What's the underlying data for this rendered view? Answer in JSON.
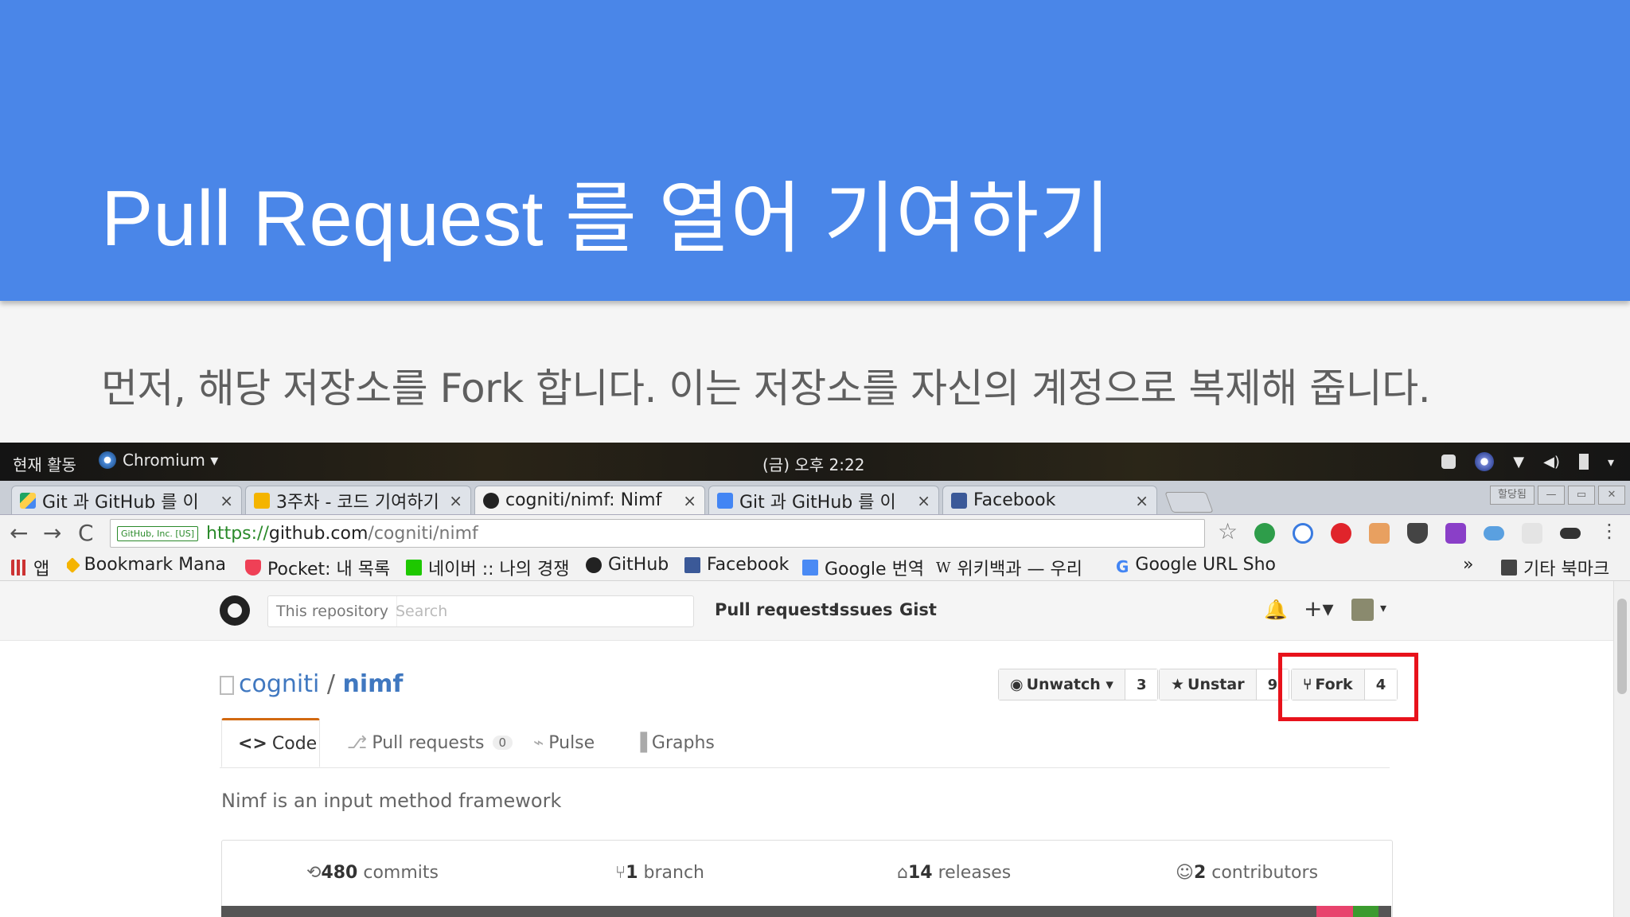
{
  "slide": {
    "title": "Pull Request 를 열어 기여하기",
    "subtitle": "먼저, 해당 저장소를 Fork 합니다. 이는 저장소를 자신의 계정으로 복제해 줍니다."
  },
  "desktop": {
    "activities": "현재 활동",
    "app_menu": "Chromium ▾",
    "clock": "(금) 오후 2:22"
  },
  "tabs": [
    {
      "title": "Git 과 GitHub 를 이",
      "close": "×"
    },
    {
      "title": "3주차 - 코드 기여하기",
      "close": "×"
    },
    {
      "title": "cogniti/nimf: Nimf",
      "close": "×"
    },
    {
      "title": "Git 과 GitHub 를 이",
      "close": "×"
    },
    {
      "title": "Facebook",
      "close": "×"
    }
  ],
  "window_controls": {
    "profile": "할당됨",
    "minimize": "—",
    "maximize": "▭",
    "close": "✕"
  },
  "toolbar": {
    "back": "←",
    "forward": "→",
    "reload": "C",
    "secure_label": "GitHub, Inc. [US]",
    "url_scheme": "https://",
    "url_host": "github.com",
    "url_path": "/cogniti/nimf"
  },
  "bookmarks": [
    {
      "label": "앱"
    },
    {
      "label": "Bookmark Mana"
    },
    {
      "label": "Pocket: 내 목록"
    },
    {
      "label": "네이버 :: 나의 경쟁"
    },
    {
      "label": "GitHub"
    },
    {
      "label": "Facebook"
    },
    {
      "label": "Google 번역"
    },
    {
      "label": "위키백과 — 우리"
    },
    {
      "label": "Google URL Sho"
    },
    {
      "label": "»"
    },
    {
      "label": "기타 북마크"
    }
  ],
  "github": {
    "search_scope": "This repository",
    "search_placeholder": "Search",
    "nav": [
      "Pull requests",
      "Issues",
      "Gist"
    ],
    "plus": "+▾",
    "repo_owner": "cogniti",
    "repo_sep": " / ",
    "repo_name": "nimf",
    "watch": {
      "label": "Unwatch ▾",
      "count": "3"
    },
    "star": {
      "label": "Unstar",
      "count": "9"
    },
    "fork": {
      "label": "Fork",
      "count": "4"
    },
    "tabs": [
      {
        "label": "Code"
      },
      {
        "label": "Pull requests",
        "count": "0"
      },
      {
        "label": "Pulse"
      },
      {
        "label": "Graphs"
      }
    ],
    "description": "Nimf is an input method framework",
    "stats": [
      {
        "value": "480",
        "label": " commits"
      },
      {
        "value": "1",
        "label": " branch"
      },
      {
        "value": "14",
        "label": " releases"
      },
      {
        "value": "2",
        "label": " contributors"
      }
    ]
  },
  "colors": {
    "slide_header": "#4a86e8",
    "highlight_box": "#e8121b",
    "link_blue": "#4078c0"
  }
}
